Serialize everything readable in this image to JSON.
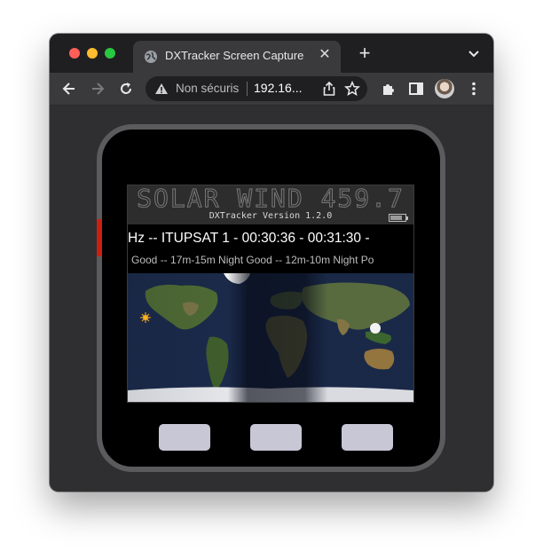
{
  "browser": {
    "tab": {
      "title": "DXTracker Screen Capture"
    },
    "address": {
      "security_label": "Non sécuris",
      "url": "192.16..."
    }
  },
  "device": {
    "header": {
      "title": "SOLAR WIND 459.7",
      "version": "DXTracker Version 1.2.0",
      "battery_level": 0.8
    },
    "ticker": "Hz -- ITUPSAT 1 - 00:30:36 - 00:31:30 -",
    "bands": "Good -- 17m-15m Night Good -- 12m-10m Night Po",
    "led_color": "#cc1f14"
  },
  "colors": {
    "tab_bg": "#3a3a3c",
    "window_bg": "#2d2d2f",
    "device_button": "#c8c7d6"
  },
  "icons": {
    "tab_favicon": "globe-icon",
    "tab_close": "close-icon",
    "new_tab": "plus-icon",
    "tab_menu": "chevron-down-icon",
    "back": "arrow-left-icon",
    "forward": "arrow-right-icon",
    "reload": "reload-icon",
    "security": "warning-icon",
    "share": "share-icon",
    "bookmark": "star-icon",
    "extensions": "puzzle-icon",
    "sidepanel": "side-panel-icon",
    "profile": "avatar",
    "menu": "kebab-menu-icon",
    "sun": "sun-icon",
    "moon": "moon-icon"
  }
}
